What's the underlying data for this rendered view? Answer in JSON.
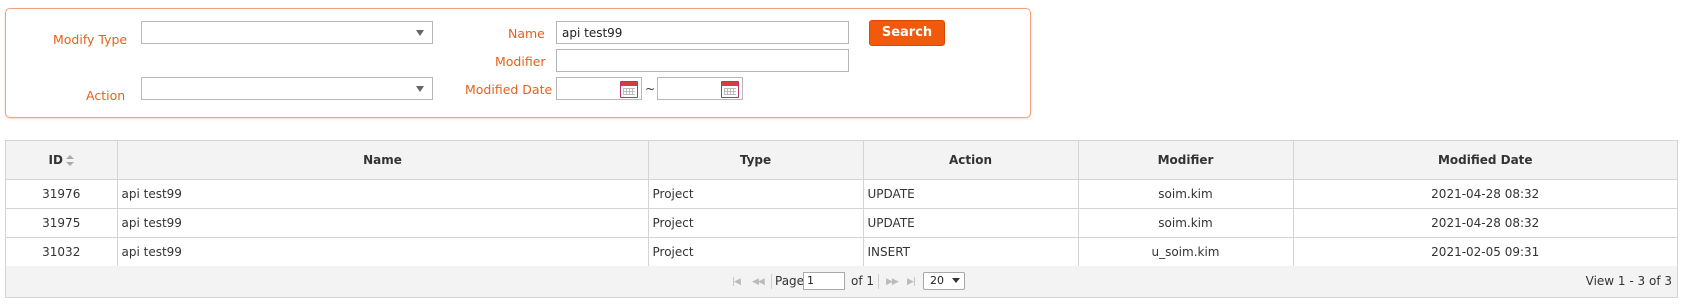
{
  "filters": {
    "modify_type_label": "Modify Type",
    "modify_type_value": "",
    "action_label": "Action",
    "action_value": "",
    "name_label": "Name",
    "name_value": "api test99",
    "modifier_label": "Modifier",
    "modifier_value": "",
    "modified_date_label": "Modified Date",
    "date_from": "",
    "date_to": "",
    "date_separator": "~",
    "search_label": "Search"
  },
  "table": {
    "columns": [
      "ID",
      "Name",
      "Type",
      "Action",
      "Modifier",
      "Modified Date"
    ],
    "rows": [
      [
        "31976",
        "api test99",
        "Project",
        "UPDATE",
        "soim.kim",
        "2021-04-28 08:32"
      ],
      [
        "31975",
        "api test99",
        "Project",
        "UPDATE",
        "soim.kim",
        "2021-04-28 08:32"
      ],
      [
        "31032",
        "api test99",
        "Project",
        "INSERT",
        "u_soim.kim",
        "2021-02-05 09:31"
      ]
    ]
  },
  "pager": {
    "page_label": "Page",
    "page_value": "1",
    "of_label": "of 1",
    "page_size": "20",
    "view_info": "View 1 - 3 of 3"
  },
  "colors": {
    "accent": "#f05a0a",
    "label_orange": "#e8601c"
  }
}
